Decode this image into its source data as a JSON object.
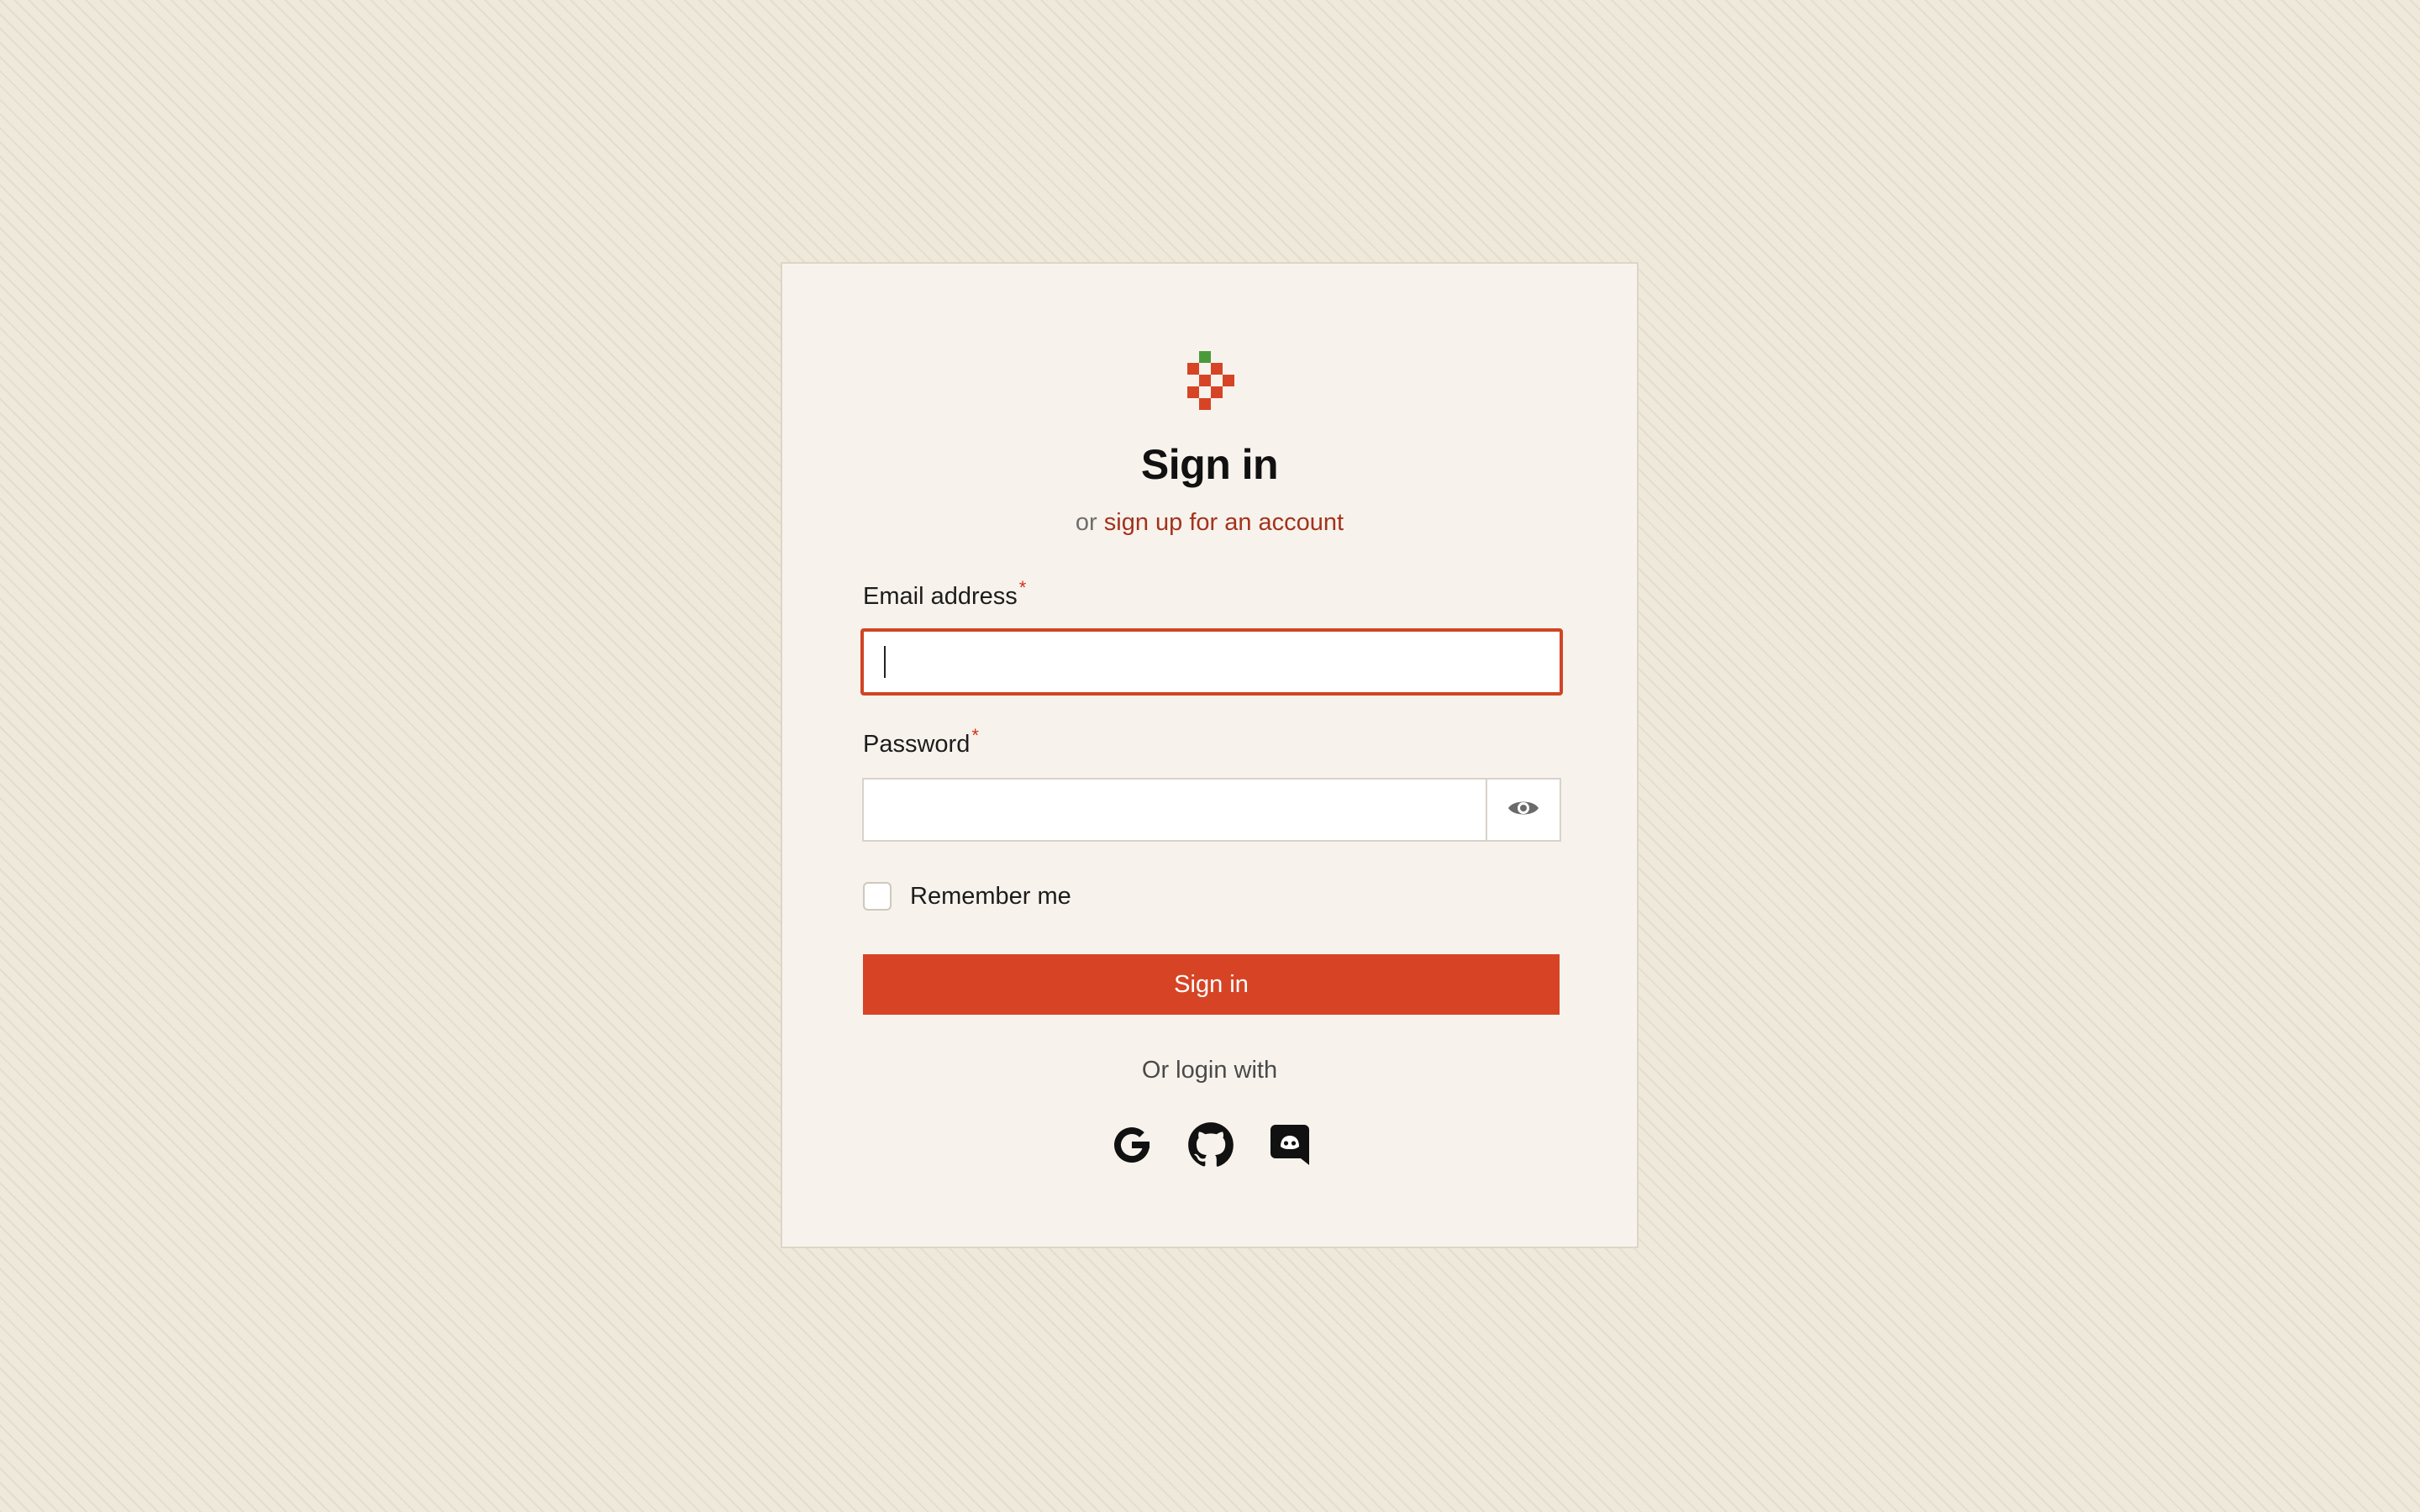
{
  "brand": {
    "accent": "#d64425",
    "link_color": "#a3321d",
    "logo_icon": "strawberry-pixel-logo-icon"
  },
  "header": {
    "title": "Sign in",
    "subtitle_prefix": "or",
    "signup_link": "sign up for an account"
  },
  "form": {
    "email_label": "Email address",
    "email_value": "",
    "password_label": "Password",
    "password_value": "",
    "required_mark": "*",
    "show_password_icon": "eye-icon",
    "remember_label": "Remember me",
    "remember_checked": false,
    "submit_label": "Sign in"
  },
  "social": {
    "divider_text": "Or login with",
    "providers": [
      {
        "name": "Google",
        "icon": "google-icon"
      },
      {
        "name": "GitHub",
        "icon": "github-icon"
      },
      {
        "name": "Discord",
        "icon": "discord-icon"
      }
    ]
  }
}
